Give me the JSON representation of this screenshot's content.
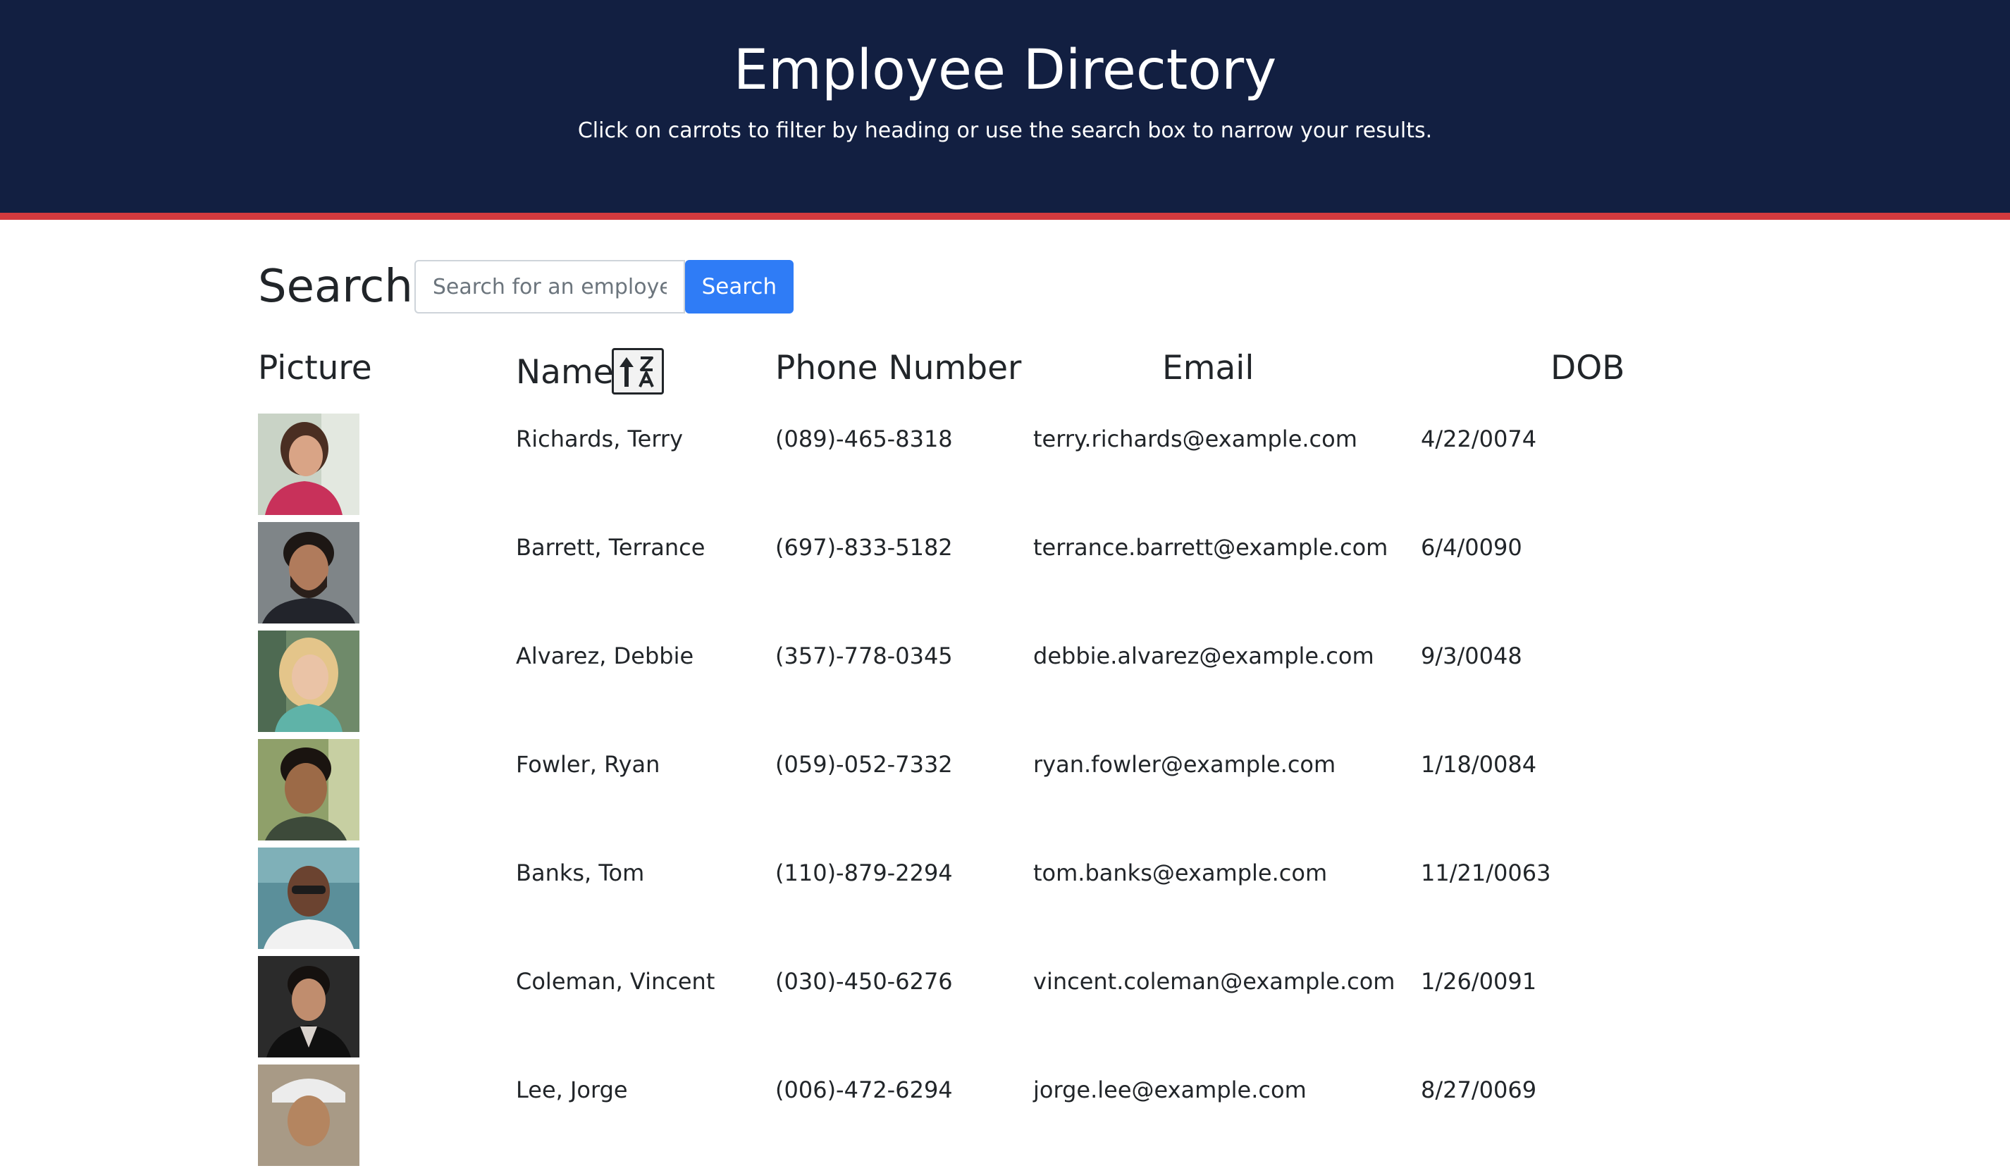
{
  "header": {
    "title": "Employee Directory",
    "subtitle": "Click on carrots to filter by heading or use the search box to narrow your results."
  },
  "search": {
    "label": "Search",
    "placeholder": "Search for an employee",
    "button_label": "Search"
  },
  "table": {
    "columns": [
      "Picture",
      "Name",
      "Phone Number",
      "Email",
      "DOB"
    ],
    "sort_icon": "sort-alpha-up-icon",
    "rows": [
      {
        "name": "Richards, Terry",
        "phone": "(089)-465-8318",
        "email": "terry.richards@example.com",
        "dob": "4/22/0074"
      },
      {
        "name": "Barrett, Terrance",
        "phone": "(697)-833-5182",
        "email": "terrance.barrett@example.com",
        "dob": "6/4/0090"
      },
      {
        "name": "Alvarez, Debbie",
        "phone": "(357)-778-0345",
        "email": "debbie.alvarez@example.com",
        "dob": "9/3/0048"
      },
      {
        "name": "Fowler, Ryan",
        "phone": "(059)-052-7332",
        "email": "ryan.fowler@example.com",
        "dob": "1/18/0084"
      },
      {
        "name": "Banks, Tom",
        "phone": "(110)-879-2294",
        "email": "tom.banks@example.com",
        "dob": "11/21/0063"
      },
      {
        "name": "Coleman, Vincent",
        "phone": "(030)-450-6276",
        "email": "vincent.coleman@example.com",
        "dob": "1/26/0091"
      },
      {
        "name": "Lee, Jorge",
        "phone": "(006)-472-6294",
        "email": "jorge.lee@example.com",
        "dob": "8/27/0069"
      }
    ]
  },
  "colors": {
    "header_bg": "#121f41",
    "header_border": "#d33a3e",
    "primary_button": "#2f7cf6"
  }
}
